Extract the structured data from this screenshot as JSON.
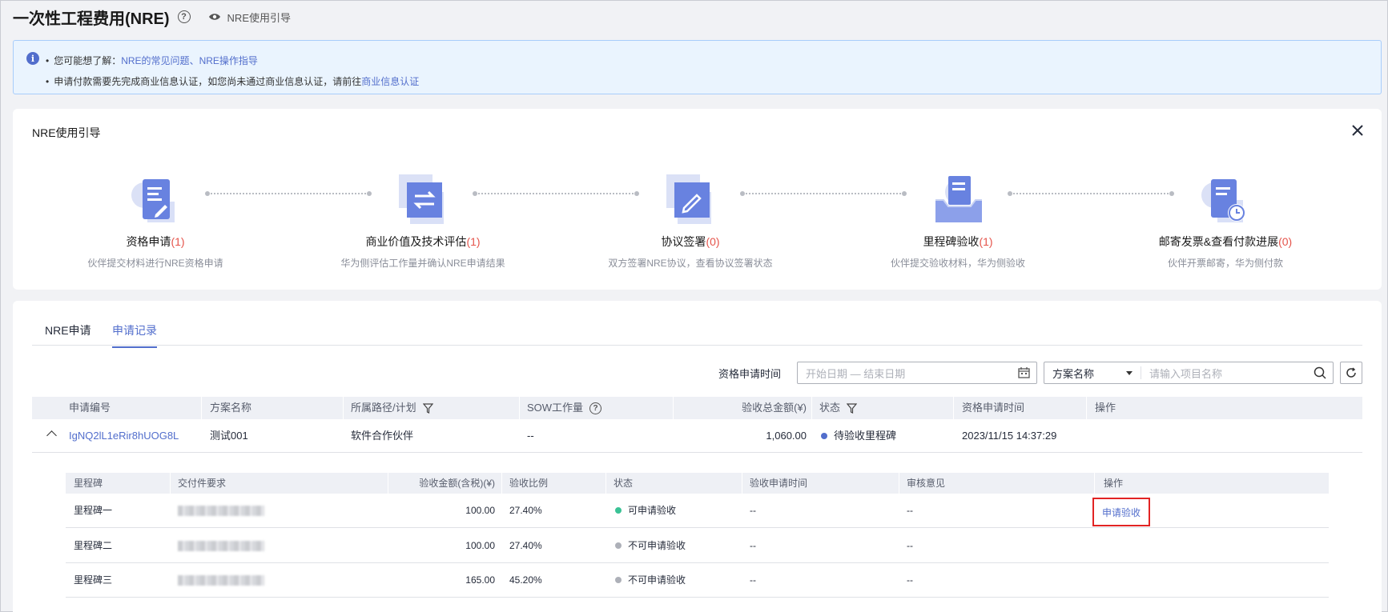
{
  "header": {
    "title": "一次性工程费用(NRE)",
    "guide_link": "NRE使用引导"
  },
  "info": {
    "line1_prefix": "您可能想了解：",
    "line1_link1": "NRE的常见问题",
    "line1_sep": "、",
    "line1_link2": "NRE操作指导",
    "line2_text": "申请付款需要先完成商业信息认证，如您尚未通过商业信息认证，请前往",
    "line2_link": "商业信息认证"
  },
  "guide": {
    "title": "NRE使用引导",
    "steps": [
      {
        "title": "资格申请",
        "count": "(1)",
        "desc": "伙伴提交材料进行NRE资格申请"
      },
      {
        "title": "商业价值及技术评估",
        "count": "(1)",
        "desc": "华为侧评估工作量并确认NRE申请结果"
      },
      {
        "title": "协议签署",
        "count": "(0)",
        "desc": "双方签署NRE协议，查看协议签署状态"
      },
      {
        "title": "里程碑验收",
        "count": "(1)",
        "desc": "伙伴提交验收材料，华为侧验收"
      },
      {
        "title": "邮寄发票&查看付款进展",
        "count": "(0)",
        "desc": "伙伴开票邮寄，华为侧付款"
      }
    ]
  },
  "tabs": {
    "apply": "NRE申请",
    "records": "申请记录"
  },
  "filters": {
    "time_label": "资格申请时间",
    "date_placeholder": "开始日期 — 结束日期",
    "select_value": "方案名称",
    "search_placeholder": "请输入项目名称"
  },
  "table": {
    "headers": {
      "id": "申请编号",
      "name": "方案名称",
      "path": "所属路径/计划",
      "sow": "SOW工作量",
      "amount": "验收总金额(¥)",
      "status": "状态",
      "time": "资格申请时间",
      "op": "操作"
    },
    "row": {
      "id": "IgNQ2lL1eRir8hUOG8L",
      "name": "测试001",
      "path": "软件合作伙伴",
      "sow": "--",
      "amount": "1,060.00",
      "status": "待验收里程碑",
      "time": "2023/11/15 14:37:29"
    }
  },
  "subtable": {
    "headers": {
      "milestone": "里程碑",
      "deliverable": "交付件要求",
      "amount": "验收金额(含税)(¥)",
      "ratio": "验收比例",
      "status": "状态",
      "apply_time": "验收申请时间",
      "opinion": "审核意见",
      "op": "操作"
    },
    "rows": [
      {
        "milestone": "里程碑一",
        "amount": "100.00",
        "ratio": "27.40%",
        "status": "可申请验收",
        "apply_time": "--",
        "opinion": "--",
        "action": "申请验收"
      },
      {
        "milestone": "里程碑二",
        "amount": "100.00",
        "ratio": "27.40%",
        "status": "不可申请验收",
        "apply_time": "--",
        "opinion": "--"
      },
      {
        "milestone": "里程碑三",
        "amount": "165.00",
        "ratio": "45.20%",
        "status": "不可申请验收",
        "apply_time": "--",
        "opinion": "--"
      }
    ]
  },
  "colors": {
    "accent": "#526ecc",
    "count_red": "#e5544b",
    "status_pending": "#526ecc",
    "status_available": "#3ac295",
    "status_unavailable": "#adb0b8",
    "highlight_box": "#e22424"
  }
}
